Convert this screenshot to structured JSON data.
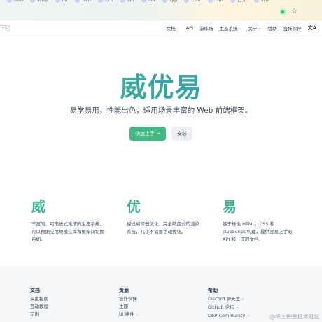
{
  "browser": {
    "bookmarks": [
      "Ron",
      "Wap",
      "Fu",
      "Sim",
      "Chr",
      "Go",
      "Gu",
      "Typ",
      "Ean",
      "Yuu",
      "音乐",
      "Wit"
    ]
  },
  "nav": {
    "search_stub": "+K",
    "items": [
      {
        "label": "文档",
        "has_dropdown": true
      },
      {
        "label": "API",
        "has_dropdown": false
      },
      {
        "label": "演练场",
        "has_dropdown": false
      },
      {
        "label": "生态系统",
        "has_dropdown": true
      },
      {
        "label": "关于",
        "has_dropdown": true
      },
      {
        "label": "赞助",
        "has_dropdown": false
      },
      {
        "label": "合作伙伴",
        "has_dropdown": false
      }
    ],
    "lang_icon": "文A"
  },
  "hero": {
    "title": "威优易",
    "subtitle": "易学易用，性能出色，适用场景丰富的 Web 前端框架。",
    "primary_button": "快速上手",
    "primary_arrow": "→",
    "secondary_button": "安装",
    "accent": "#42b883"
  },
  "features": [
    {
      "title": "威",
      "desc": "丰富的、可渐进式集成的生态系统，可以根据应用规模在库和框架间切换自如。"
    },
    {
      "title": "优",
      "desc": "经过编译器优化、完全响应式的渲染系统，几乎不需要手动优化。"
    },
    {
      "title": "易",
      "desc": "基于标准 HTML、CSS 和 JavaScript 构建，提供容易上手的 API 和一流的文档。"
    }
  ],
  "footer": {
    "columns": [
      {
        "heading": "文档",
        "links": [
          {
            "label": "深度指南",
            "external": false
          },
          {
            "label": "互动教程",
            "external": false
          },
          {
            "label": "示例",
            "external": false
          }
        ]
      },
      {
        "heading": "资源",
        "links": [
          {
            "label": "合作伙伴",
            "external": false
          },
          {
            "label": "主题",
            "external": false
          },
          {
            "label": "UI 组件",
            "external": true
          }
        ]
      },
      {
        "heading": "帮助",
        "links": [
          {
            "label": "Discord 聊天室",
            "external": true
          },
          {
            "label": "GitHub 论坛",
            "external": true
          },
          {
            "label": "DEV Community",
            "external": true
          }
        ]
      }
    ]
  },
  "watermark": "@稀土掘金技术社区"
}
